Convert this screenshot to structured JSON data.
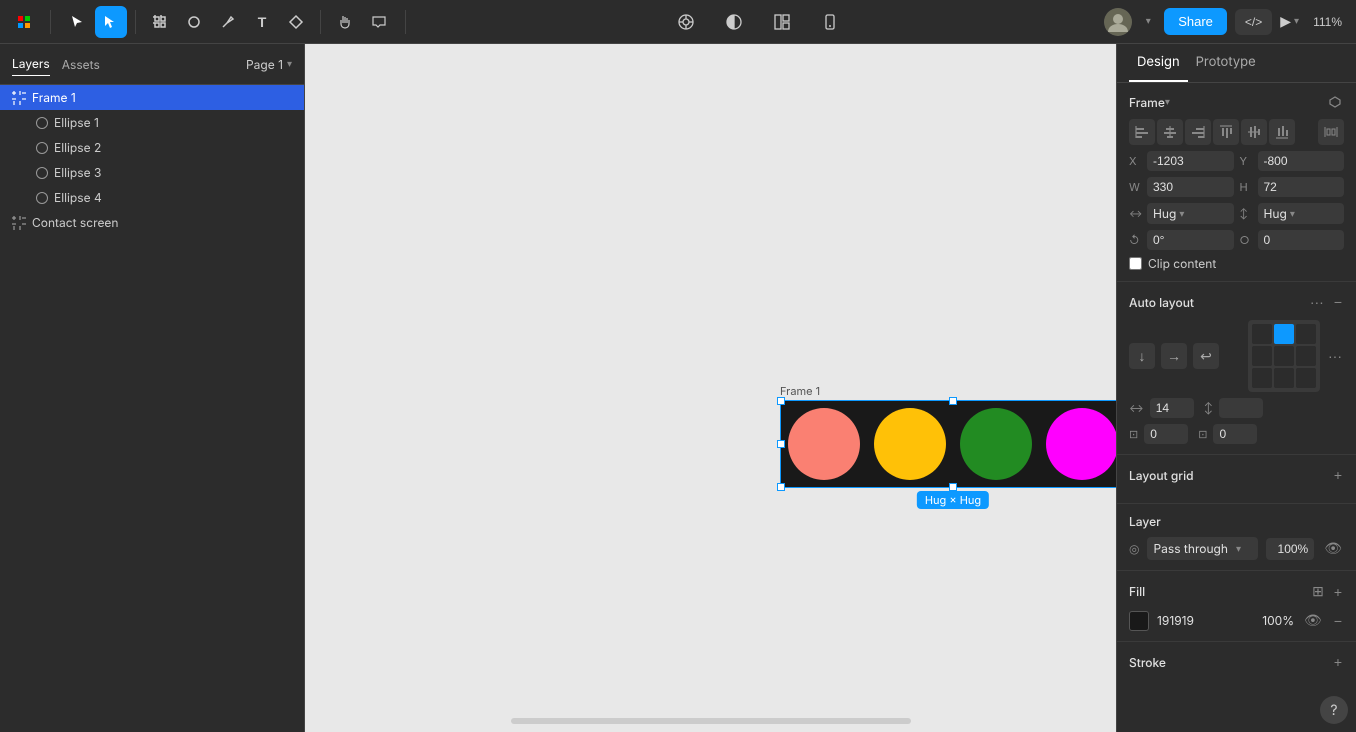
{
  "toolbar": {
    "tools": [
      {
        "name": "cursor-tool",
        "icon": "↖",
        "active": false
      },
      {
        "name": "move-tool",
        "icon": "⊹",
        "active": true
      },
      {
        "name": "frame-tool",
        "icon": "⬜",
        "active": false
      },
      {
        "name": "shape-tool",
        "icon": "○",
        "active": false
      },
      {
        "name": "pen-tool",
        "icon": "✏",
        "active": false
      },
      {
        "name": "text-tool",
        "icon": "T",
        "active": false
      },
      {
        "name": "component-tool",
        "icon": "⧉",
        "active": false
      },
      {
        "name": "hand-tool",
        "icon": "✋",
        "active": false
      },
      {
        "name": "comment-tool",
        "icon": "💬",
        "active": false
      }
    ],
    "share_label": "Share",
    "zoom_level": "111%",
    "play_label": "▶"
  },
  "left_panel": {
    "tabs": [
      {
        "label": "Layers",
        "active": true
      },
      {
        "label": "Assets",
        "active": false
      }
    ],
    "page_selector": "Page 1",
    "layers": [
      {
        "id": "frame1",
        "label": "Frame 1",
        "type": "frame",
        "indented": false,
        "selected": true
      },
      {
        "id": "ellipse1",
        "label": "Ellipse 1",
        "type": "ellipse",
        "indented": true,
        "selected": false
      },
      {
        "id": "ellipse2",
        "label": "Ellipse 2",
        "type": "ellipse",
        "indented": true,
        "selected": false
      },
      {
        "id": "ellipse3",
        "label": "Ellipse 3",
        "type": "ellipse",
        "indented": true,
        "selected": false
      },
      {
        "id": "ellipse4",
        "label": "Ellipse 4",
        "type": "ellipse",
        "indented": true,
        "selected": false
      },
      {
        "id": "contact",
        "label": "Contact screen",
        "type": "frame",
        "indented": false,
        "selected": false
      }
    ]
  },
  "canvas": {
    "frame_label": "Frame 1",
    "hug_label": "Hug × Hug",
    "ellipses": [
      {
        "color": "#FA8072",
        "name": "coral"
      },
      {
        "color": "#FFC107",
        "name": "yellow"
      },
      {
        "color": "#228B22",
        "name": "green"
      },
      {
        "color": "#FF00FF",
        "name": "magenta"
      }
    ]
  },
  "right_panel": {
    "tabs": [
      {
        "label": "Design",
        "active": true
      },
      {
        "label": "Prototype",
        "active": false
      }
    ],
    "frame_section": {
      "title": "Frame",
      "x_label": "X",
      "x_value": "-1203",
      "y_label": "Y",
      "y_value": "-800",
      "w_label": "W",
      "w_value": "330",
      "h_label": "H",
      "h_value": "72",
      "rotation_label": "°",
      "rotation_value": "0°",
      "corner_label": "○",
      "corner_value": "0",
      "resizex_label": "Hug",
      "resizey_label": "Hug",
      "clip_content_label": "Clip content"
    },
    "auto_layout": {
      "title": "Auto layout",
      "gap_value": "14",
      "pad_left": "0",
      "pad_right": "0"
    },
    "layout_grid": {
      "title": "Layout grid"
    },
    "layer": {
      "title": "Layer",
      "blend_mode": "Pass through",
      "opacity": "100%"
    },
    "fill": {
      "title": "Fill",
      "color": "#191919",
      "color_hex": "191919",
      "opacity": "100%"
    },
    "stroke": {
      "title": "Stroke"
    }
  }
}
